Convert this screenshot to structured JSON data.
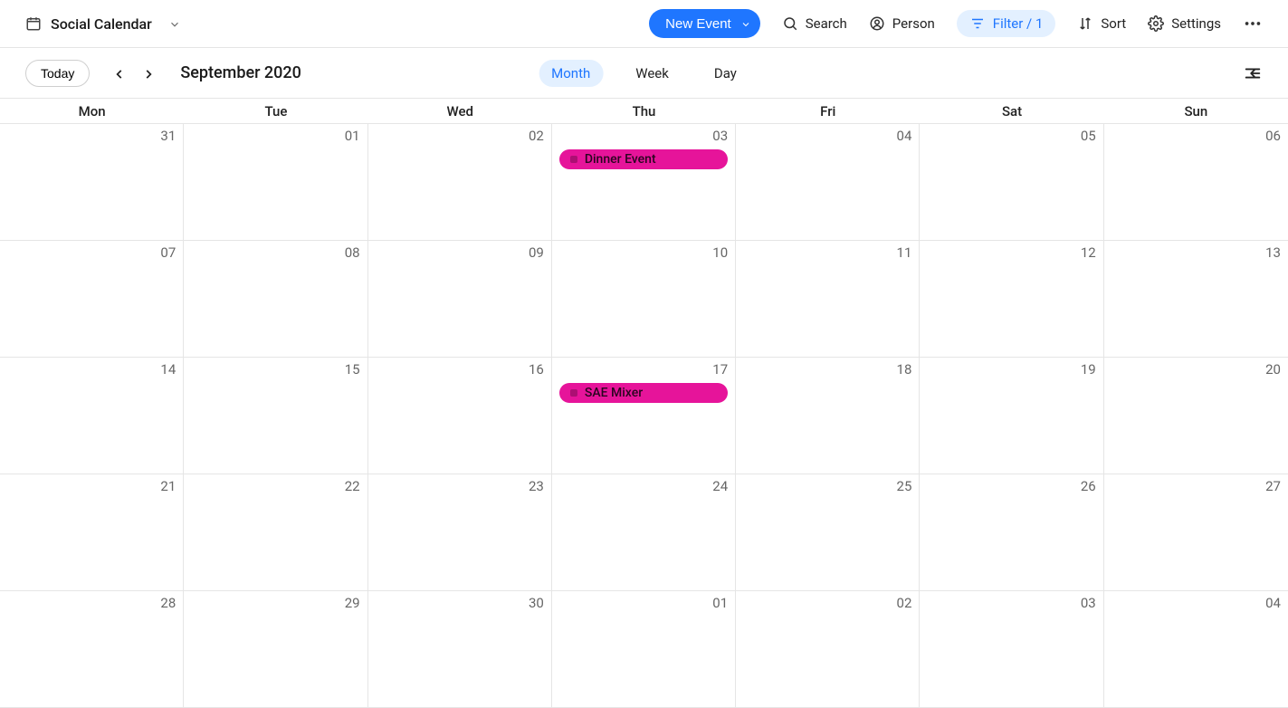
{
  "header": {
    "calendar_name": "Social Calendar",
    "new_event": "New Event",
    "search": "Search",
    "person": "Person",
    "filter": "Filter / 1",
    "sort": "Sort",
    "settings": "Settings"
  },
  "nav": {
    "today": "Today",
    "title": "September 2020",
    "views": {
      "month": "Month",
      "week": "Week",
      "day": "Day"
    }
  },
  "weekdays": [
    "Mon",
    "Tue",
    "Wed",
    "Thu",
    "Fri",
    "Sat",
    "Sun"
  ],
  "grid": [
    [
      "31",
      "01",
      "02",
      "03",
      "04",
      "05",
      "06"
    ],
    [
      "07",
      "08",
      "09",
      "10",
      "11",
      "12",
      "13"
    ],
    [
      "14",
      "15",
      "16",
      "17",
      "18",
      "19",
      "20"
    ],
    [
      "21",
      "22",
      "23",
      "24",
      "25",
      "26",
      "27"
    ],
    [
      "28",
      "29",
      "30",
      "01",
      "02",
      "03",
      "04"
    ]
  ],
  "events": [
    {
      "row": 0,
      "col": 3,
      "title": "Dinner Event",
      "color": "#e6149a"
    },
    {
      "row": 2,
      "col": 3,
      "title": "SAE Mixer",
      "color": "#e6149a"
    }
  ]
}
